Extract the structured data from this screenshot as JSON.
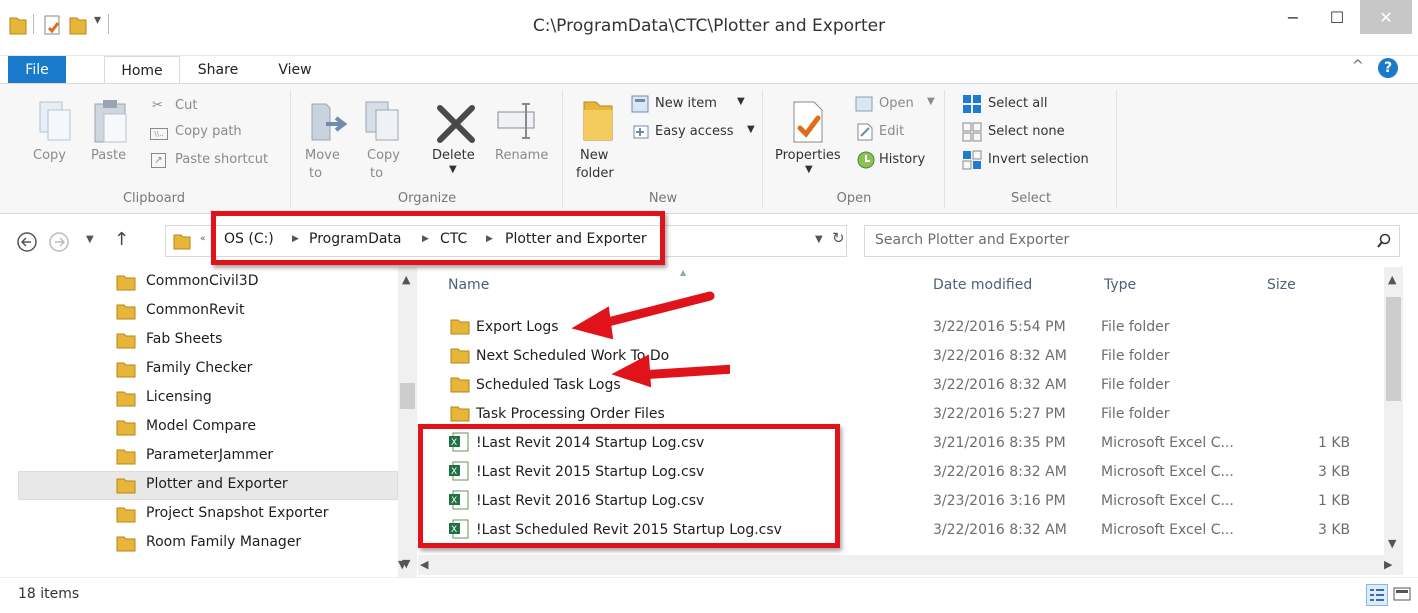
{
  "window": {
    "title": "C:\\ProgramData\\CTC\\Plotter and Exporter",
    "minimize": "−",
    "maximize": "☐",
    "close": "✕"
  },
  "tabs": [
    "File",
    "Home",
    "Share",
    "View"
  ],
  "ribbon": {
    "clipboard": {
      "copy": "Copy",
      "paste": "Paste",
      "cut": "Cut",
      "copy_path": "Copy path",
      "paste_shortcut": "Paste shortcut",
      "label": "Clipboard"
    },
    "organize": {
      "move_to_1": "Move",
      "move_to_2": "to",
      "copy_to_1": "Copy",
      "copy_to_2": "to",
      "delete": "Delete",
      "rename": "Rename",
      "label": "Organize"
    },
    "new": {
      "new_folder_1": "New",
      "new_folder_2": "folder",
      "new_item": "New item",
      "easy_access": "Easy access",
      "label": "New"
    },
    "open": {
      "properties": "Properties",
      "open": "Open",
      "edit": "Edit",
      "history": "History",
      "label": "Open"
    },
    "select": {
      "select_all": "Select all",
      "select_none": "Select none",
      "invert": "Invert selection",
      "label": "Select"
    }
  },
  "address": {
    "crumbs": [
      "OS (C:)",
      "ProgramData",
      "CTC",
      "Plotter and Exporter"
    ],
    "search_placeholder": "Search Plotter and Exporter"
  },
  "nav": {
    "items": [
      "CommonCivil3D",
      "CommonRevit",
      "Fab Sheets",
      "Family Checker",
      "Licensing",
      "Model Compare",
      "ParameterJammer",
      "Plotter and Exporter",
      "Project Snapshot Exporter",
      "Room Family Manager"
    ],
    "selected_index": 7
  },
  "columns": {
    "name": "Name",
    "date": "Date modified",
    "type": "Type",
    "size": "Size"
  },
  "files": [
    {
      "name": "Export Logs",
      "date": "3/22/2016 5:54 PM",
      "type": "File folder",
      "size": "",
      "kind": "folder"
    },
    {
      "name": "Next Scheduled Work To Do",
      "date": "3/22/2016 8:32 AM",
      "type": "File folder",
      "size": "",
      "kind": "folder"
    },
    {
      "name": "Scheduled Task Logs",
      "date": "3/22/2016 8:32 AM",
      "type": "File folder",
      "size": "",
      "kind": "folder"
    },
    {
      "name": "Task Processing Order Files",
      "date": "3/22/2016 5:27 PM",
      "type": "File folder",
      "size": "",
      "kind": "folder"
    },
    {
      "name": "!Last Revit 2014 Startup Log.csv",
      "date": "3/21/2016 8:35 PM",
      "type": "Microsoft Excel C...",
      "size": "1 KB",
      "kind": "csv"
    },
    {
      "name": "!Last Revit 2015 Startup Log.csv",
      "date": "3/22/2016 8:32 AM",
      "type": "Microsoft Excel C...",
      "size": "3 KB",
      "kind": "csv"
    },
    {
      "name": "!Last Revit 2016 Startup Log.csv",
      "date": "3/23/2016 3:16 PM",
      "type": "Microsoft Excel C...",
      "size": "1 KB",
      "kind": "csv"
    },
    {
      "name": "!Last Scheduled Revit 2015 Startup Log.csv",
      "date": "3/22/2016 8:32 AM",
      "type": "Microsoft Excel C...",
      "size": "3 KB",
      "kind": "csv"
    }
  ],
  "status": {
    "count": "18 items"
  },
  "colors": {
    "accent": "#1979ca",
    "annotation": "#e0121a",
    "folder": "#e8b53b"
  }
}
